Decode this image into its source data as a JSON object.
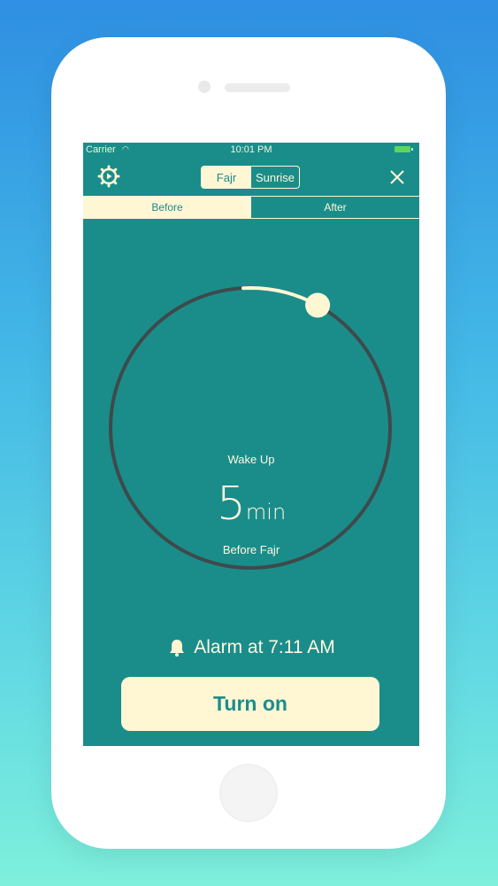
{
  "statusbar": {
    "carrier": "Carrier",
    "time": "10:01 PM",
    "battery_color": "#5fd65a"
  },
  "navbar": {
    "settings_icon": "gear-icon",
    "segments": [
      {
        "label": "Fajr",
        "selected": true
      },
      {
        "label": "Sunrise",
        "selected": false
      }
    ],
    "close_icon": "close-icon"
  },
  "tabs": [
    {
      "label": "Before",
      "selected": true
    },
    {
      "label": "After",
      "selected": false
    }
  ],
  "dial": {
    "title": "Wake Up",
    "value": "5",
    "unit": "min",
    "subtitle": "Before Fajr",
    "progress_fraction": 0.08
  },
  "alarm": {
    "icon": "bell-icon",
    "text": "Alarm at 7:11 AM"
  },
  "action": {
    "turn_on_label": "Turn on"
  },
  "colors": {
    "accent": "#1a8d8b",
    "cream": "#fff6d4",
    "track": "#3e4a4a"
  }
}
